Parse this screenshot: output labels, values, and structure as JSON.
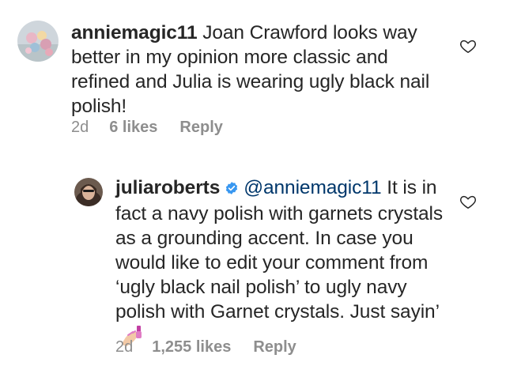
{
  "comments": [
    {
      "username": "anniemagic11",
      "text": "Joan Crawford looks way better in my opinion more classic and refined  and Julia is wearing ugly black nail polish!",
      "time": "2d",
      "likes": "6 likes",
      "reply_label": "Reply"
    }
  ],
  "reply": {
    "username": "juliaroberts",
    "verified_icon": "verified-badge-icon",
    "mention": "@anniemagic11",
    "text": "It is in fact a navy polish with garnets crystals as a grounding accent. In case you would like to edit your comment from ‘ugly black nail polish’ to ugly navy polish with Garnet crystals. Just sayin’",
    "emoji": "nail-polish-emoji",
    "time": "2d",
    "likes": "1,255 likes",
    "reply_label": "Reply"
  },
  "colors": {
    "text": "#262626",
    "meta": "#8e8e8e",
    "verified": "#3897f0",
    "mention": "#00376b"
  }
}
